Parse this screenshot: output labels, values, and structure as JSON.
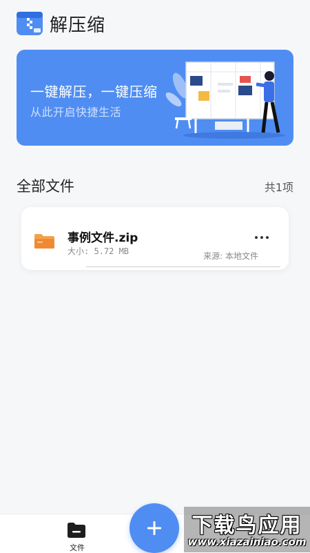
{
  "app": {
    "title": "解压缩",
    "logo_icon": "zip-archive-icon"
  },
  "banner": {
    "headline": "一键解压，一键压缩",
    "subtitle": "从此开启快捷生活",
    "background_color": "#4f8df2"
  },
  "files_section": {
    "title": "全部文件",
    "count_label": "共1项"
  },
  "files": [
    {
      "name": "事例文件.zip",
      "size": "大小: 5.72 MB",
      "source": "来源: 本地文件",
      "icon": "folder-icon",
      "icon_color": "#f5a04a"
    }
  ],
  "bottom_nav": {
    "file_tab_label": "文件",
    "file_tab_icon": "folder-icon",
    "fab_icon": "plus-icon",
    "fab_color": "#4f8df2"
  },
  "watermark": {
    "title": "下载鸟应用",
    "url": "www.xiazainiao.com"
  }
}
